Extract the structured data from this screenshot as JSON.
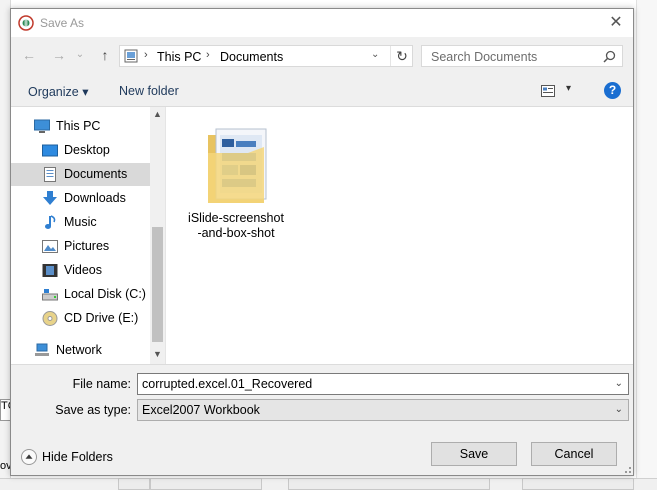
{
  "dialog": {
    "title": "Save As",
    "close_glyph": "✕"
  },
  "nav": {
    "back_glyph": "←",
    "forward_glyph": "→",
    "recent_glyph": "⌄",
    "up_glyph": "↑"
  },
  "address": {
    "crumbs": [
      "This PC",
      "Documents"
    ],
    "separator": "›",
    "dropdown_glyph": "⌄",
    "refresh_glyph": "↻"
  },
  "search": {
    "placeholder": "Search Documents"
  },
  "toolbar": {
    "organize_label": "Organize ▾",
    "new_folder_label": "New folder",
    "view_drop_glyph": "▾",
    "help_glyph": "?"
  },
  "sidebar": {
    "items": [
      {
        "label": "This PC",
        "icon": "pc-icon"
      },
      {
        "label": "Desktop",
        "icon": "desktop-icon"
      },
      {
        "label": "Documents",
        "icon": "documents-icon",
        "selected": true
      },
      {
        "label": "Downloads",
        "icon": "downloads-icon"
      },
      {
        "label": "Music",
        "icon": "music-icon"
      },
      {
        "label": "Pictures",
        "icon": "pictures-icon"
      },
      {
        "label": "Videos",
        "icon": "videos-icon"
      },
      {
        "label": "Local Disk (C:)",
        "icon": "local-disk-icon"
      },
      {
        "label": "CD Drive (E:)",
        "icon": "cd-drive-icon"
      },
      {
        "label": "Network",
        "icon": "network-icon"
      }
    ],
    "scroll_up_glyph": "▲",
    "scroll_down_glyph": "▼"
  },
  "files": [
    {
      "name": "iSlide-screenshot-and-box-shot"
    }
  ],
  "fields": {
    "file_name_label": "File name:",
    "file_name_value": "corrupted.excel.01_Recovered",
    "save_type_label": "Save as type:",
    "save_type_value": "Excel2007 Workbook",
    "dropdown_glyph": "⌄"
  },
  "footer": {
    "hide_folders_label": "Hide Folders",
    "save_label": "Save",
    "cancel_label": "Cancel"
  },
  "background": {
    "fragment_top": "TC",
    "fragment_bottom": "ov"
  },
  "colors": {
    "accent": "#1a6ed1",
    "selected": "#d9d9d9",
    "link": "#1e395b"
  }
}
